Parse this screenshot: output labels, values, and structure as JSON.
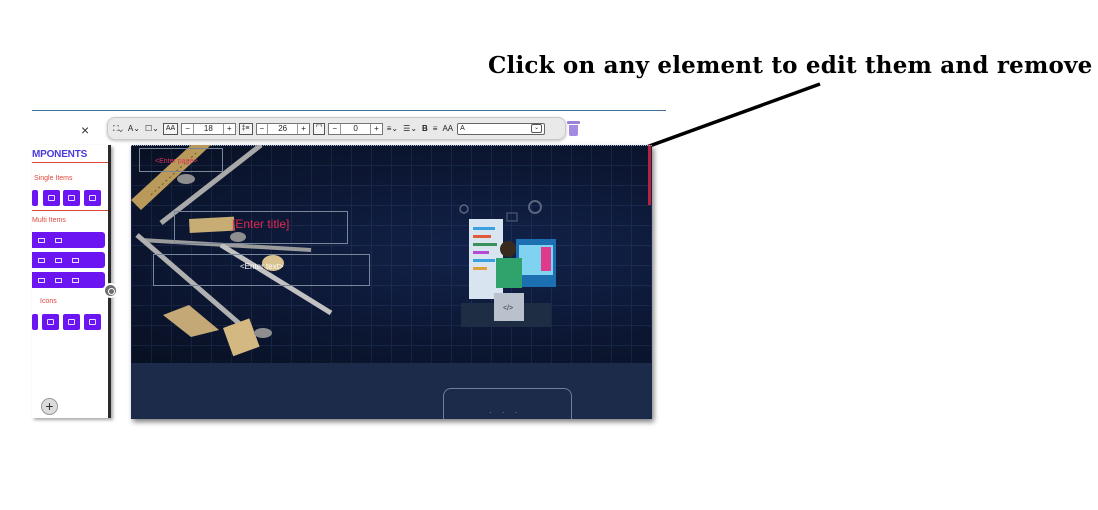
{
  "headline": "Click on any element to edit them and remove",
  "toolbar": {
    "fill_label": "⛶⌄",
    "text_color_label": "A⌄",
    "border_label": "☐⌄",
    "font_size_icon": "AA",
    "font_size": {
      "minus": "−",
      "value": "18",
      "plus": "+"
    },
    "line_height_icon": "‡≡",
    "line_height": {
      "minus": "−",
      "value": "26",
      "plus": "+"
    },
    "radius_icon": "⌜⌝",
    "radius": {
      "minus": "−",
      "value": "0",
      "plus": "+"
    },
    "align_label": "≡⌄",
    "list_label": "☰⌄",
    "bold_label": "B",
    "strike_label": "≡",
    "case_label": "AA",
    "font_select": {
      "value": "A",
      "chevron": "⌄"
    }
  },
  "close_label": "×",
  "sidebar": {
    "title": "MPONENTS",
    "single_items_label": "Single Items",
    "multi_items_label": "Multi Items",
    "icons_label": "Icons",
    "add_label": "+"
  },
  "canvas": {
    "page_placeholder": "<Enter page>",
    "title_placeholder": "[Enter title]",
    "text_placeholder": "<Enter text>",
    "dots": "· · ·"
  },
  "colors": {
    "accent_purple": "#6b16f2",
    "placeholder_red": "#e0284e",
    "canvas_navy": "#0c1526"
  },
  "icons": [
    "close-icon",
    "trash-icon",
    "add-icon",
    "sidebar-toggle-icon",
    "github-icon",
    "linkedin-icon",
    "youtube-icon"
  ]
}
